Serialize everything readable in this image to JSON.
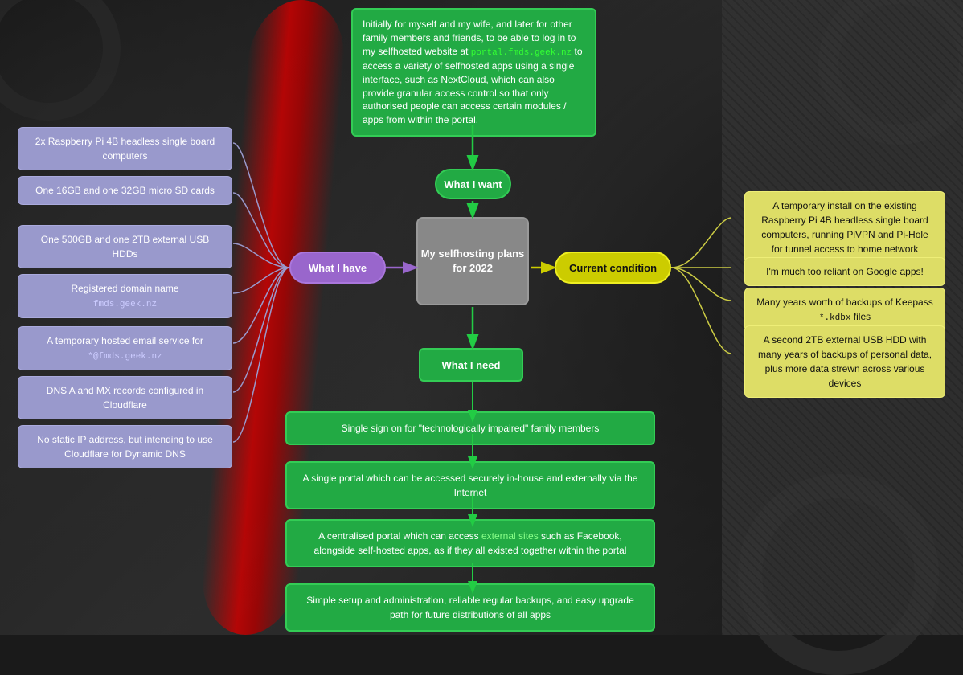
{
  "background": {
    "color": "#1a1a1a"
  },
  "center_node": {
    "title": "My selfhosting plans for 2022"
  },
  "nodes": {
    "what_i_want": "What I want",
    "what_i_have": "What I have",
    "what_i_need": "What I need",
    "current_condition": "Current condition"
  },
  "top_description": {
    "text_before_link": "Initially for myself and my wife, and later for other family members and friends, to be able to log in to my selfhosted website at ",
    "link": "portal.fmds.geek.nz",
    "text_after_link": " to access a variety of selfhosted apps using a single interface, such as NextCloud, which can also provide granular access control so that only authorised people can access certain modules / apps from within the portal."
  },
  "left_items": [
    "2x Raspberry Pi 4B headless single board computers",
    "One 16GB and one 32GB micro SD cards",
    "One 500GB and one 2TB external USB HDDs",
    "Registered domain name\nfmds.geek.nz",
    "A temporary hosted email service for\n*@fmds.geek.nz",
    "DNS A and MX records configured in Cloudflare",
    "No static IP address, but intending to use Cloudflare for Dynamic DNS"
  ],
  "left_items_domain": "fmds.geek.nz",
  "left_items_email": "*@fmds.geek.nz",
  "right_items": [
    "A temporary install on the existing Raspberry Pi 4B headless single board computers, running PiVPN and Pi-Hole for tunnel access to home network",
    "I'm much too reliant on Google apps!",
    "Many years worth of backups of Keepass *.kdbx files",
    "A second 2TB external USB HDD with many years of backups of personal data, plus more data strewn across various devices"
  ],
  "right_items_kdbx": "*.kdbx",
  "bottom_items": [
    "Single sign on for \"technologically impaired\" family members",
    "A single portal which can be accessed securely in-house and externally via the Internet",
    "A centralised portal which can access {external sites} such as Facebook, alongside self-hosted apps, as if they all existed together within the portal",
    "Simple setup and administration, reliable regular backups, and easy upgrade path for future distributions of all apps"
  ],
  "bottom_item_external_sites_text": "external sites"
}
